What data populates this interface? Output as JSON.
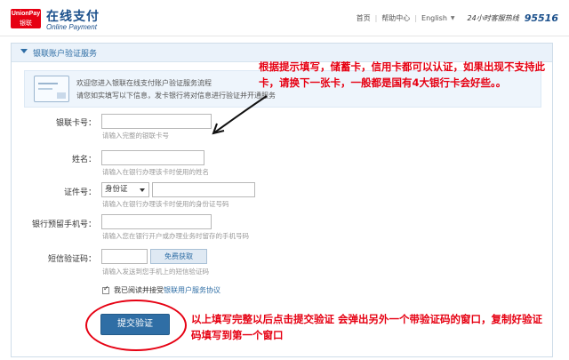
{
  "header": {
    "logo_line1": "UnionPay",
    "logo_line2": "银联",
    "brand": "在线支付",
    "brand_sub": "Online Payment",
    "nav": [
      "首页",
      "帮助中心",
      "English"
    ],
    "hotline_label": "24小时客服热线",
    "hotline_number": "95516"
  },
  "panel": {
    "title": "银联账户验证服务",
    "banner_line1": "欢迎您进入银联在线支付账户验证服务流程",
    "banner_line2": "请您如实填写以下信息，发卡银行将对信息进行验证并开通服务"
  },
  "form": {
    "card_label": "银联卡号：",
    "card_hint": "请输入完整的银联卡号",
    "name_label": "姓名：",
    "name_hint": "请输入在银行办理该卡时使用的姓名",
    "id_label": "证件号：",
    "id_type": "身份证",
    "id_hint": "请输入在银行办理该卡时使用的身份证号码",
    "phone_label": "银行预留手机号：",
    "phone_hint": "请输入您在银行开户或办理业务时留存的手机号码",
    "sms_label": "短信验证码：",
    "sms_button": "免费获取",
    "sms_hint": "请输入发送到您手机上的短信验证码",
    "agree_text": "我已阅读并接受",
    "agree_link": "银联用户服务协议",
    "submit": "提交验证"
  },
  "annotations": {
    "note1": "根据提示填写，储蓄卡，信用卡都可以认证，如果出现不支持此卡，请换下一张卡，一般都是国有4大银行卡会好些。。",
    "note2": "以上填写完整以后点击提交验证 会弹出另外一个带验证码的窗口，复制好验证码填写到第一个窗口"
  },
  "colors": {
    "brand_blue": "#1a4f8b",
    "accent_blue": "#2f6ea5",
    "annotation_red": "#e60012"
  }
}
